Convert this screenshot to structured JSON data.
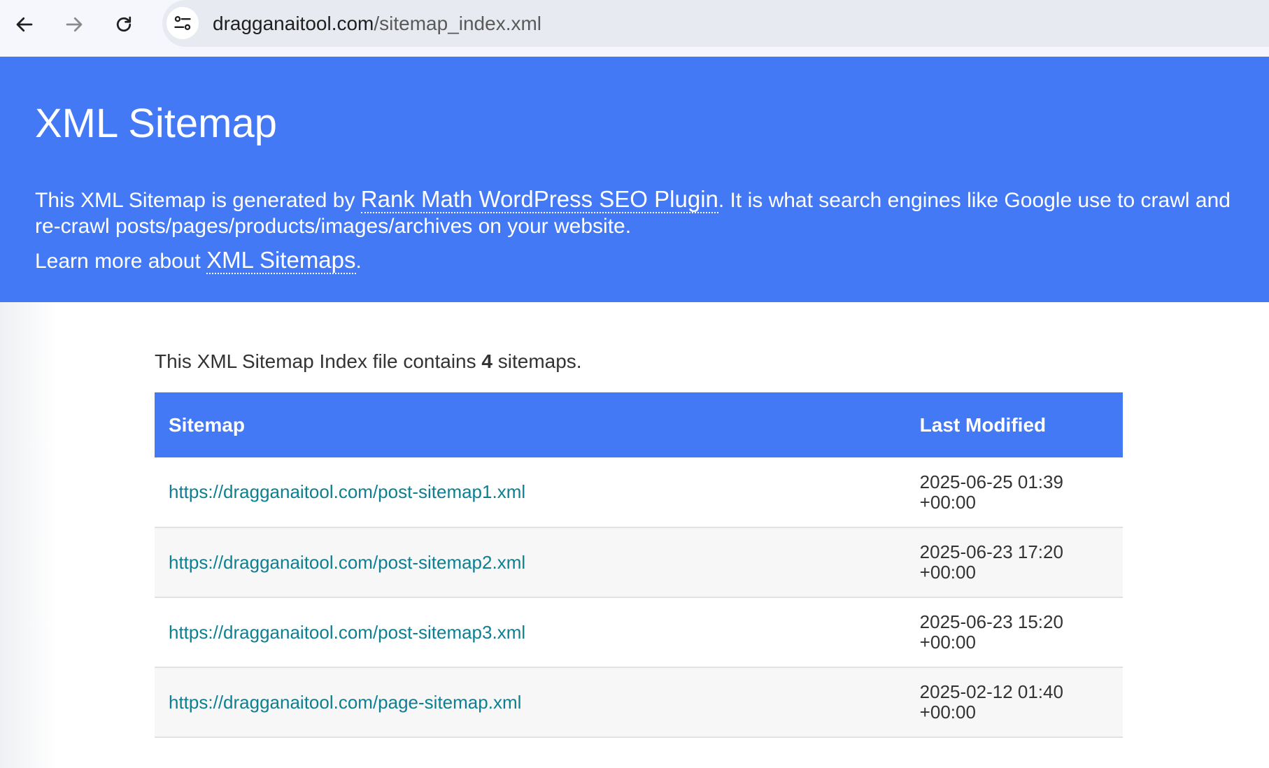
{
  "browser": {
    "url_host": "dragganaitool.com",
    "url_path": "/sitemap_index.xml",
    "icons": [
      "back-arrow-icon",
      "forward-arrow-icon",
      "reload-icon",
      "site-settings-icon"
    ]
  },
  "header": {
    "title": "XML Sitemap",
    "desc_before": "This XML Sitemap is generated by ",
    "desc_link": "Rank Math WordPress SEO Plugin",
    "desc_after": ". It is what search engines like Google use to crawl and re-crawl posts/pages/products/images/archives on your website.",
    "learn_before": "Learn more about ",
    "learn_link": "XML Sitemaps",
    "learn_after": "."
  },
  "summary": {
    "before": "This XML Sitemap Index file contains ",
    "count": "4",
    "after": " sitemaps."
  },
  "table": {
    "headers": {
      "sitemap": "Sitemap",
      "last_modified": "Last Modified"
    },
    "rows": [
      {
        "url": "https://dragganaitool.com/post-sitemap1.xml",
        "date": "2025-06-25 01:39 +00:00"
      },
      {
        "url": "https://dragganaitool.com/post-sitemap2.xml",
        "date": "2025-06-23 17:20 +00:00"
      },
      {
        "url": "https://dragganaitool.com/post-sitemap3.xml",
        "date": "2025-06-23 15:20 +00:00"
      },
      {
        "url": "https://dragganaitool.com/page-sitemap.xml",
        "date": "2025-02-12 01:40 +00:00"
      }
    ]
  },
  "colors": {
    "banner": "#4479f5",
    "link": "#0d7f91",
    "row_alt": "#f7f7f7"
  }
}
